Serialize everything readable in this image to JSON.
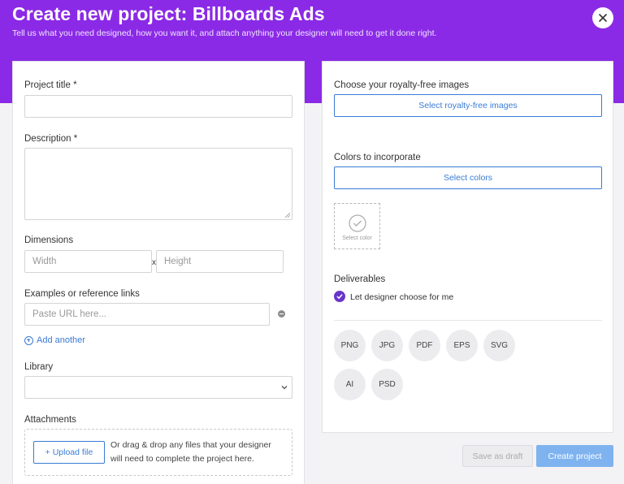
{
  "header": {
    "title": "Create new project: Billboards Ads",
    "subtitle": "Tell us what you need designed, how you want it, and attach anything your designer will need to get it done right."
  },
  "form": {
    "project_title_label": "Project title *",
    "description_label": "Description *",
    "dimensions_label": "Dimensions",
    "width_placeholder": "Width",
    "separator": "x",
    "height_placeholder": "Height",
    "examples_label": "Examples or reference links",
    "url_placeholder": "Paste URL here...",
    "add_another": "Add another",
    "library_label": "Library",
    "attachments_label": "Attachments",
    "upload_button": "+ Upload file",
    "drop_text_line1": "Or drag & drop any files that your designer",
    "drop_text_line2": "will need to complete the project here."
  },
  "options": {
    "images_label": "Choose your royalty-free images",
    "images_button": "Select royalty-free images",
    "colors_label": "Colors to incorporate",
    "colors_button": "Select colors",
    "swatch_label": "Select color",
    "deliverables_label": "Deliverables",
    "designer_choose_label": "Let designer choose for me",
    "designer_choose_checked": true,
    "formats": [
      "PNG",
      "JPG",
      "PDF",
      "EPS",
      "SVG",
      "AI",
      "PSD"
    ]
  },
  "footer": {
    "save_draft": "Save as draft",
    "create_project": "Create project"
  },
  "colors": {
    "brand_purple": "#8b2ae6",
    "link_blue": "#3a7bd5",
    "check_purple": "#6a35c9",
    "create_button": "#7fb3f0"
  }
}
